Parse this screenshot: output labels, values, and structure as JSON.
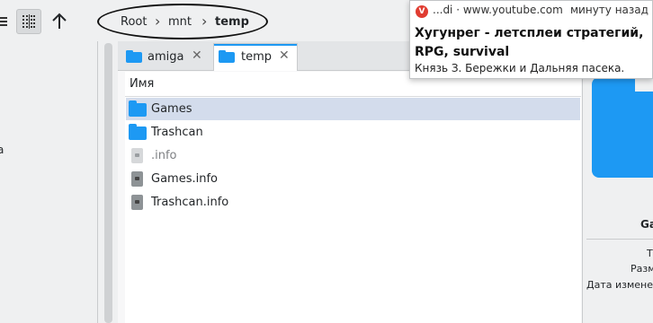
{
  "breadcrumb": {
    "items": [
      "Root",
      "mnt",
      "temp"
    ]
  },
  "tabs": [
    {
      "label": "amiga",
      "active": false
    },
    {
      "label": "temp",
      "active": true
    }
  ],
  "columns": {
    "name": "Имя"
  },
  "files": [
    {
      "name": "Games",
      "type": "folder",
      "selected": true
    },
    {
      "name": "Trashcan",
      "type": "folder",
      "selected": false
    },
    {
      "name": ".info",
      "type": "info-file-hidden",
      "selected": false
    },
    {
      "name": "Games.info",
      "type": "info-file",
      "selected": false
    },
    {
      "name": "Trashcan.info",
      "type": "info-file",
      "selected": false
    }
  ],
  "left_panel": {
    "partial_label": "a"
  },
  "info_panel": {
    "title_partial": "Ga",
    "labels_partial": [
      "Т",
      "Разм",
      "Дата изменен"
    ]
  },
  "tooltip": {
    "source": "...di · www.youtube.com",
    "time": "минуту назад",
    "title": "Хугунрег - летсплеи стратегий, RPG, survival",
    "subtitle": "Князь З. Бережки и Дальняя пасека."
  },
  "colors": {
    "accent": "#1d99f3",
    "selection": "#d3dcec",
    "tooltip_logo": "#e03c31"
  }
}
